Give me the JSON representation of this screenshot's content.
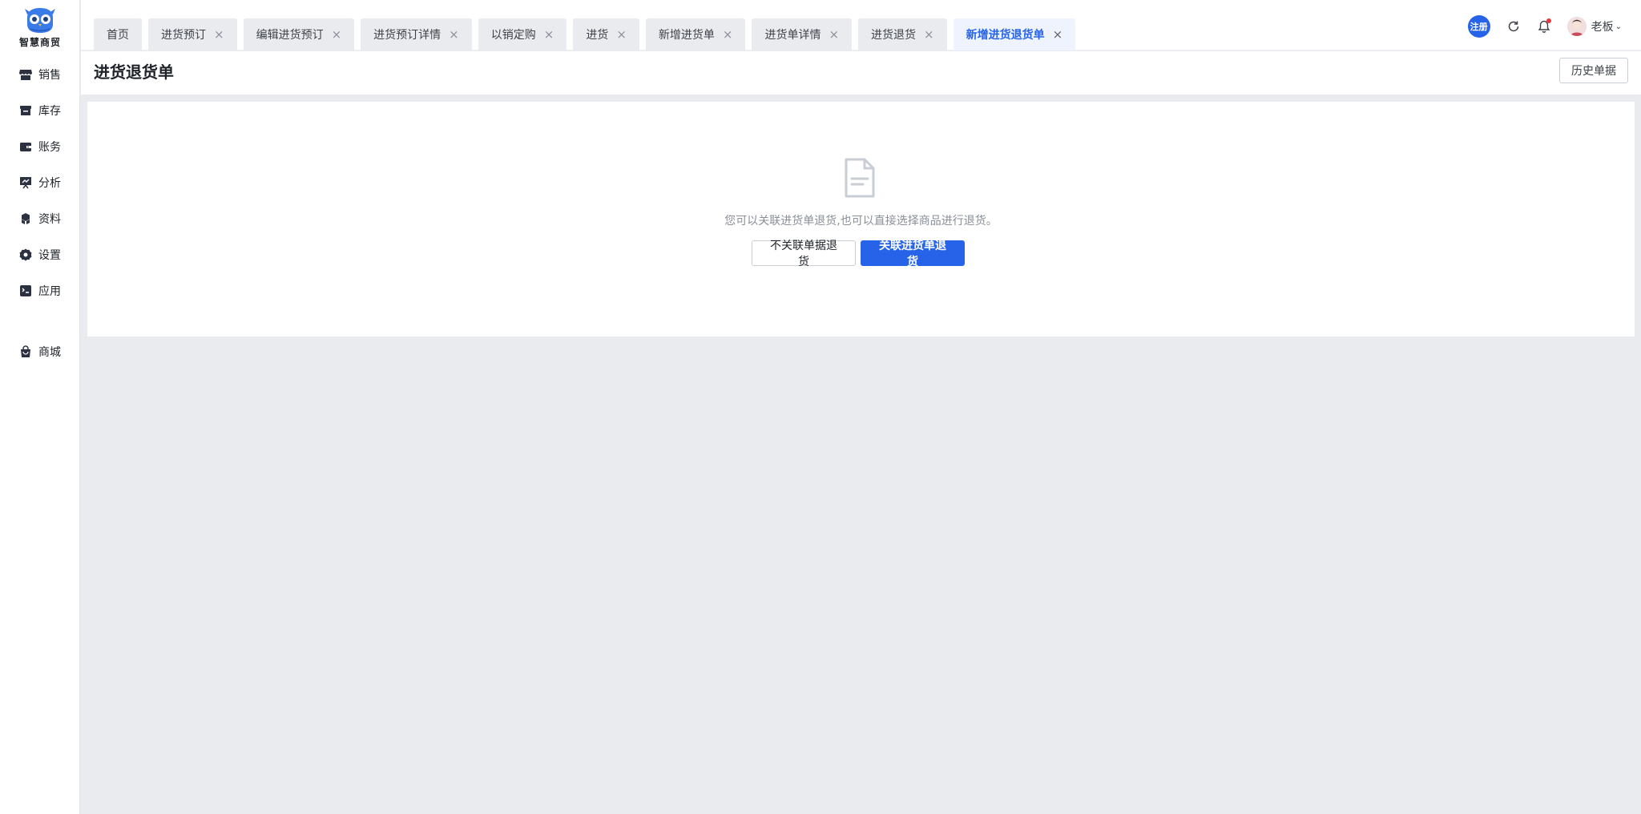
{
  "brand": {
    "name": "智慧商贸"
  },
  "sidebar": {
    "items": [
      {
        "label": "销售",
        "icon": "store-icon"
      },
      {
        "label": "库存",
        "icon": "box-icon"
      },
      {
        "label": "账务",
        "icon": "wallet-icon"
      },
      {
        "label": "分析",
        "icon": "presentation-chart-icon"
      },
      {
        "label": "资料",
        "icon": "cubes-icon"
      },
      {
        "label": "设置",
        "icon": "gear-icon"
      },
      {
        "label": "应用",
        "icon": "apps-icon"
      },
      {
        "label": "商城",
        "icon": "shopping-bag-icon"
      }
    ]
  },
  "tabs": [
    {
      "label": "首页",
      "closable": false
    },
    {
      "label": "进货预订",
      "closable": true
    },
    {
      "label": "编辑进货预订",
      "closable": true
    },
    {
      "label": "进货预订详情",
      "closable": true
    },
    {
      "label": "以销定购",
      "closable": true
    },
    {
      "label": "进货",
      "closable": true
    },
    {
      "label": "新增进货单",
      "closable": true
    },
    {
      "label": "进货单详情",
      "closable": true
    },
    {
      "label": "进货退货",
      "closable": true
    },
    {
      "label": "新增进货退货单",
      "closable": true,
      "active": true
    }
  ],
  "topbar": {
    "register_label": "注册",
    "refresh_icon": "refresh-icon",
    "bell_icon": "bell-icon",
    "has_notification": true,
    "user_name": "老板",
    "chevron": "⌄"
  },
  "page": {
    "title": "进货退货单",
    "history_button": "历史单据"
  },
  "empty_state": {
    "icon": "document-icon",
    "hint": "您可以关联进货单退货,也可以直接选择商品进行退货。",
    "secondary_button": "不关联单据退货",
    "primary_button": "关联进货单退货"
  },
  "colors": {
    "accent": "#2663e9",
    "background": "#eaebee",
    "notification_dot": "#e4393c"
  }
}
